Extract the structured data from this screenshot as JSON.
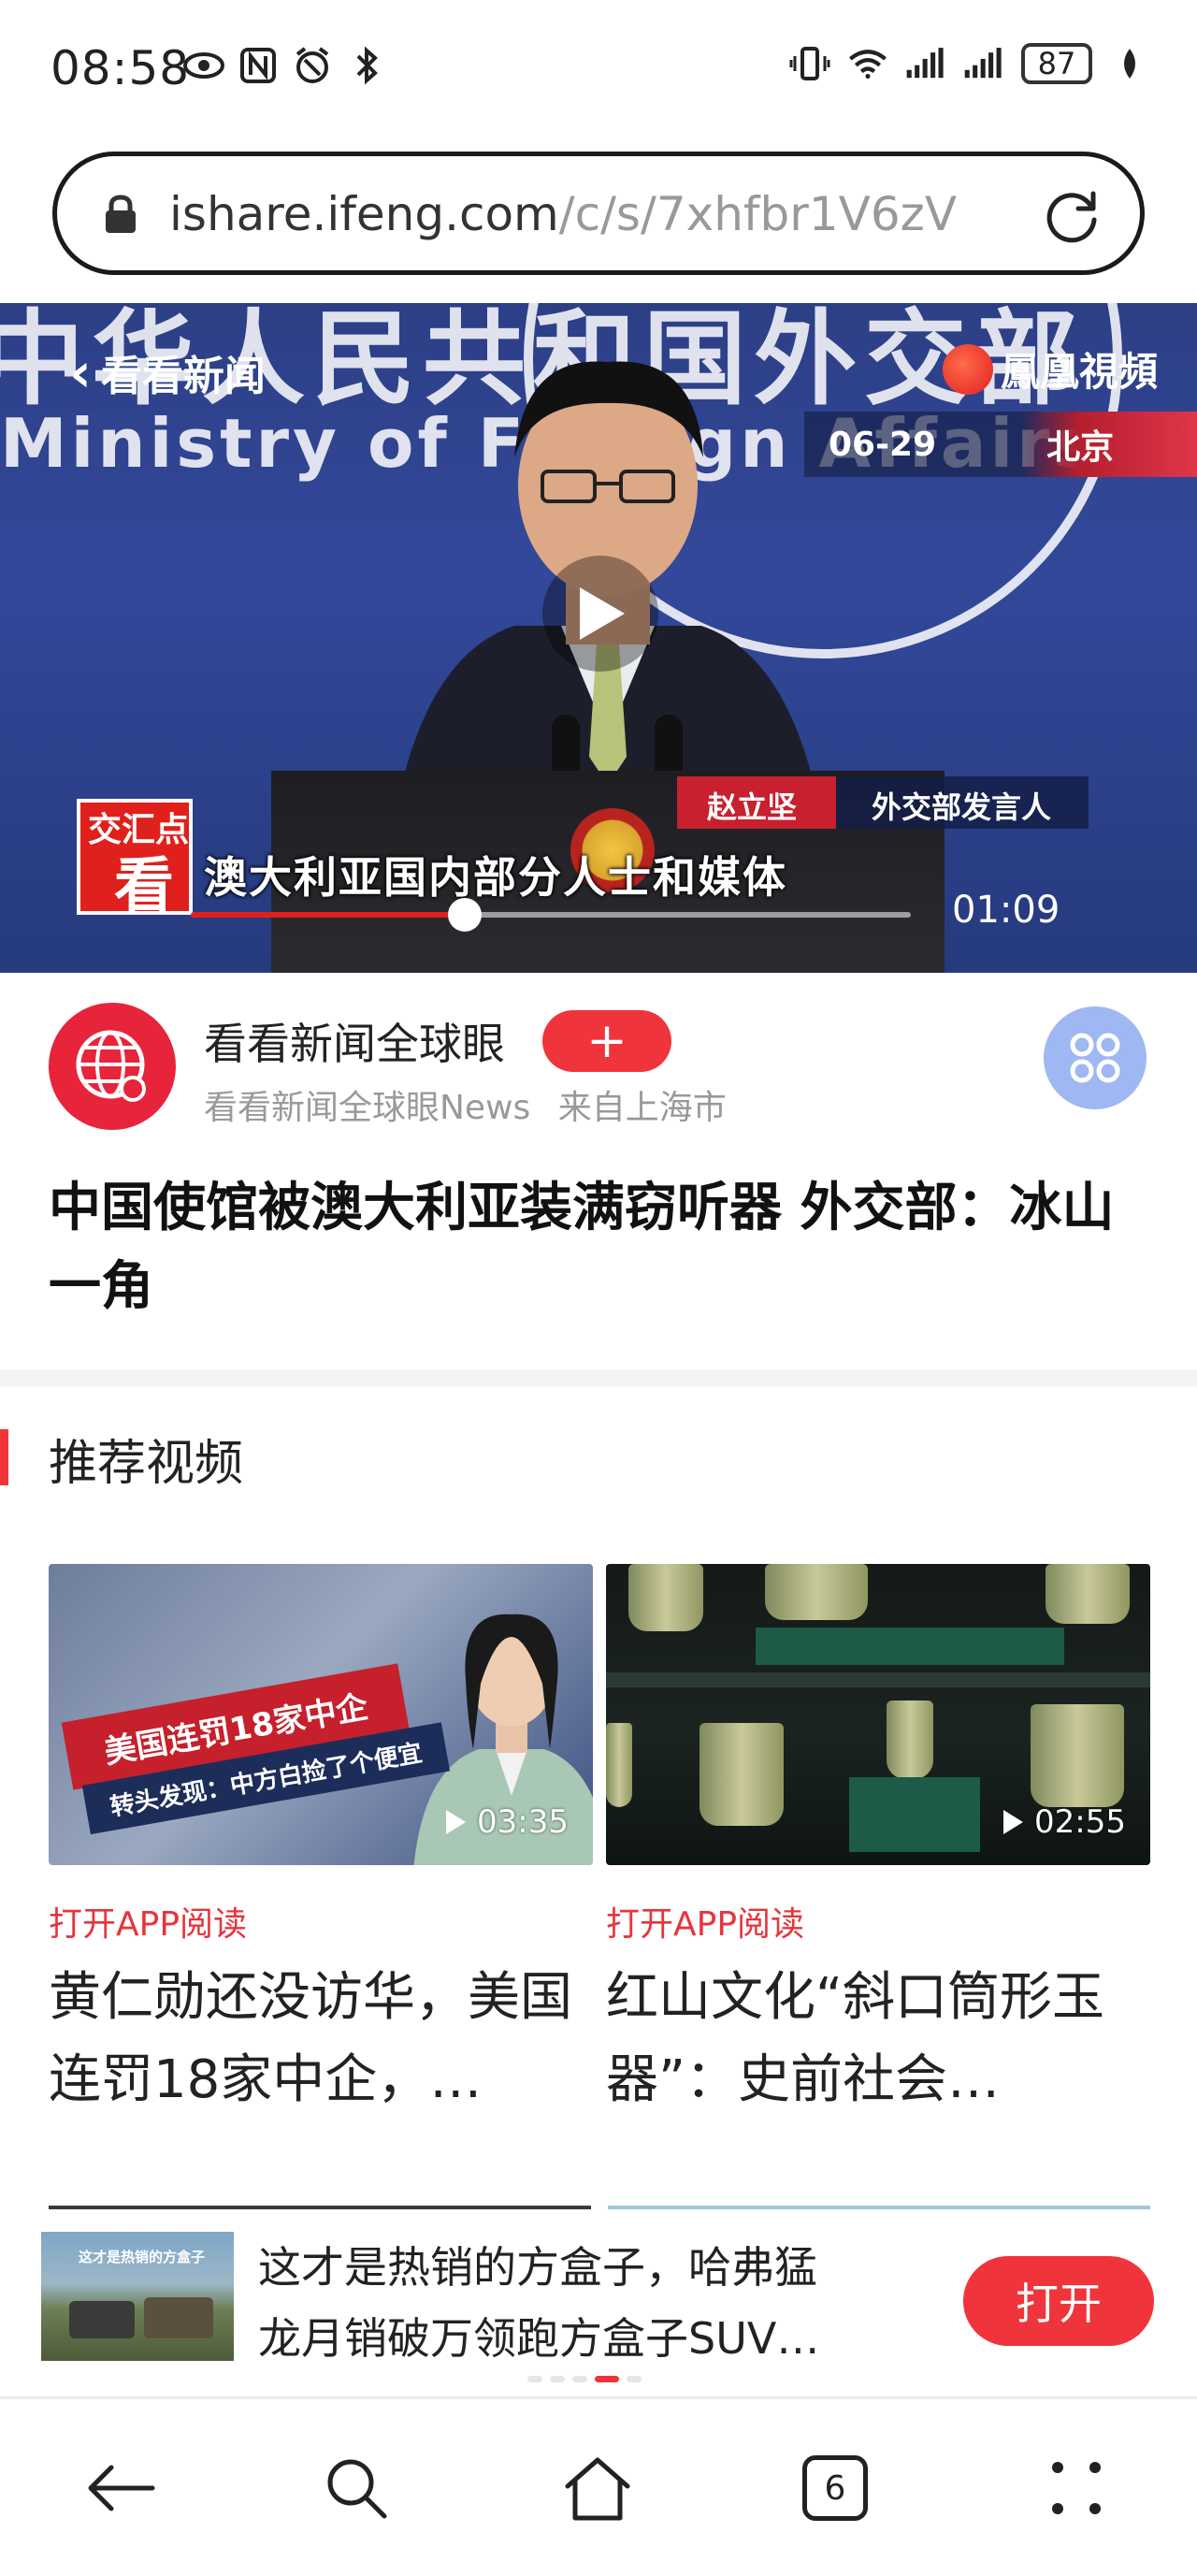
{
  "status_bar": {
    "time": "08:58",
    "battery": "87",
    "icons": [
      "eye-icon",
      "nfc-icon",
      "alarm-icon",
      "bluetooth-icon",
      "vibrate-icon",
      "wifi-icon",
      "signal-icon",
      "signal-icon",
      "battery-icon",
      "leaf-icon"
    ]
  },
  "url_bar": {
    "host": "ishare.ifeng.com",
    "path": "/c/s/7xhfbr1V6zV"
  },
  "video": {
    "bg_headline": "中华人民共和国外交部",
    "bg_english": "Ministry of Foreign Affairs",
    "channel_logo": "看看新闻",
    "brand_logo": "鳳凰視頻",
    "date": "06-29",
    "city": "北京",
    "speaker_name": "赵立坚",
    "speaker_title": "外交部发言人",
    "program_logo_top": "交汇点",
    "program_logo_main": "看",
    "subtitle": "澳大利亚国内部分人士和媒体",
    "duration": "01:09",
    "progress_fraction": 0.38
  },
  "author": {
    "name": "看看新闻全球眼",
    "follow_label": "+",
    "handle": "看看新闻全球眼News",
    "location": "来自上海市"
  },
  "article": {
    "headline": "中国使馆被澳大利亚装满窃听器 外交部：冰山一角"
  },
  "recommended": {
    "section_title": "推荐视频",
    "cards": [
      {
        "duration": "03:35",
        "open_label": "打开APP阅读",
        "title": "黄仁勋还没访华，美国连罚18家中企，…",
        "thumb_line1": "美国连罚18家中企",
        "thumb_line2": "转头发现：中方白捡了个便宜"
      },
      {
        "duration": "02:55",
        "open_label": "打开APP阅读",
        "title": "红山文化“斜口筒形玉器”：史前社会…"
      }
    ]
  },
  "ad": {
    "thumb_caption": "这才是热销的方盒子",
    "text": "这才是热销的方盒子，哈弗猛龙月销破万领跑方盒子SUV…",
    "open_label": "打开",
    "active_dot": 3
  },
  "nav": {
    "tabs_count": "6"
  },
  "colors": {
    "accent": "#f0343c",
    "link_red": "#e8343c",
    "grid_button": "#9fb7f2"
  }
}
